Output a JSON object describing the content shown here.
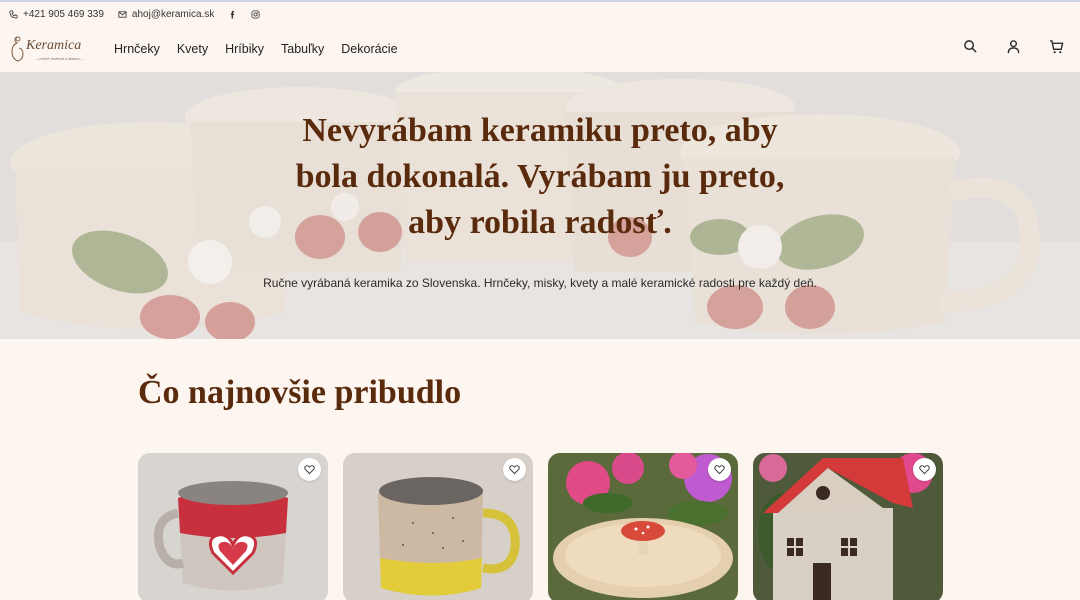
{
  "topbar": {
    "phone": "+421 905 469 339",
    "email": "ahoj@keramica.sk",
    "social": [
      "facebook-icon",
      "instagram-icon"
    ]
  },
  "header": {
    "logo_text": "Keramica",
    "logo_tagline": "– ručně tvořená s láskou –",
    "nav": [
      "Hrnčeky",
      "Kvety",
      "Hríbiky",
      "Tabuľky",
      "Dekorácie"
    ],
    "icons": [
      "search-icon",
      "user-icon",
      "cart-icon"
    ]
  },
  "hero": {
    "title_lines": [
      "Nevyrábam keramiku preto, aby",
      "bola dokonalá. Vyrábam ju preto,",
      "aby robila radosť."
    ],
    "subtitle": "Ručne vyrábaná keramika zo Slovenska. Hrnčeky, misky, kvety a malé keramické radosti pre každý deň."
  },
  "section": {
    "title": "Čo najnovšie pribudlo"
  },
  "products": [
    {
      "image": "mug-red-heart"
    },
    {
      "image": "mug-yellow-dotted"
    },
    {
      "image": "dish-with-mushroom"
    },
    {
      "image": "ceramic-house-red-roof"
    }
  ],
  "colors": {
    "background": "#fdf6f0",
    "heading": "#5a2a0c",
    "text": "#222222"
  }
}
